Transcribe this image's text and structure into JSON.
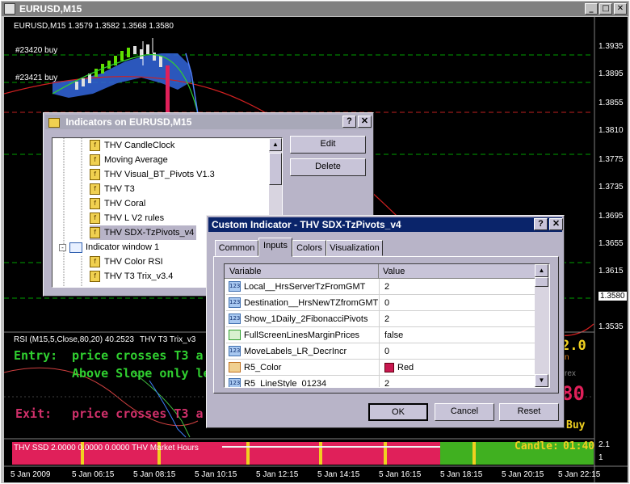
{
  "window": {
    "title": "EURUSD,M15"
  },
  "chart": {
    "header": "EURUSD,M15  1.3579 1.3582 1.3568 1.3580",
    "order_labels": [
      "#23420 buy",
      "#23421 buy"
    ],
    "price_labels": [
      "1.3935",
      "1.3895",
      "1.3855",
      "1.3810",
      "1.3775",
      "1.3735",
      "1.3695",
      "1.3655",
      "1.3615",
      "1.3580",
      "1.3535"
    ],
    "current_price": "1.3580",
    "rsi_header": "RSI (M15,5,Close,80,20) 40.2523",
    "t3_header": "THV T3 Trix_v3",
    "entry_label": "Entry:",
    "entry_text": "price crosses T3 a",
    "entry_text2": "Above Slope only le",
    "exit_label": "Exit:",
    "exit_text": "price crosses T3 a",
    "right_big": "2.0",
    "right_small": "n",
    "right_small2": "rex",
    "right_80": "80",
    "right_buy": "Buy",
    "ssd_header": "THV SSD 2.0000 0.0000 0.0000  THV Market Hours",
    "candle_label": "Candle:",
    "candle_time": "01:40",
    "sub_scale": [
      "2.1",
      "1"
    ],
    "time_labels": [
      "5 Jan 2009",
      "5 Jan 06:15",
      "5 Jan 08:15",
      "5 Jan 10:15",
      "5 Jan 12:15",
      "5 Jan 14:15",
      "5 Jan 16:15",
      "5 Jan 18:15",
      "5 Jan 20:15",
      "5 Jan 22:15"
    ]
  },
  "indicators_dialog": {
    "title": "Indicators on EURUSD,M15",
    "help": "?",
    "close": "✕",
    "items": [
      "THV CandleClock",
      "Moving Average",
      "THV Visual_BT_Pivots V1.3",
      "THV T3",
      "THV Coral",
      "THV L  V2 rules",
      "THV SDX-TzPivots_v4"
    ],
    "window_item": "Indicator window 1",
    "sub_items": [
      "THV Color RSI",
      "THV T3 Trix_v3.4"
    ],
    "edit": "Edit",
    "delete": "Delete"
  },
  "custom_dialog": {
    "title": "Custom Indicator - THV SDX-TzPivots_v4",
    "help": "?",
    "close": "✕",
    "tabs": [
      "Common",
      "Inputs",
      "Colors",
      "Visualization"
    ],
    "col_variable": "Variable",
    "col_value": "Value",
    "rows": [
      {
        "icon": "123",
        "variable": "Local__HrsServerTzFromGMT",
        "value": "2"
      },
      {
        "icon": "123",
        "variable": "Destination__HrsNewTZfromGMT",
        "value": "0"
      },
      {
        "icon": "123",
        "variable": "Show_1Daily_2FibonacciPivots",
        "value": "2"
      },
      {
        "icon": "chart",
        "variable": "FullScreenLinesMarginPrices",
        "value": "false"
      },
      {
        "icon": "123",
        "variable": "MoveLabels_LR_DecrIncr",
        "value": "0"
      },
      {
        "icon": "color",
        "variable": "R5_Color",
        "value": "Red"
      },
      {
        "icon": "123",
        "variable": "R5_LineStyle_01234",
        "value": "2"
      }
    ],
    "ok": "OK",
    "cancel": "Cancel",
    "reset": "Reset",
    "colors": {
      "swatch": "#c81850",
      "title_bar": "#0a246a"
    }
  }
}
